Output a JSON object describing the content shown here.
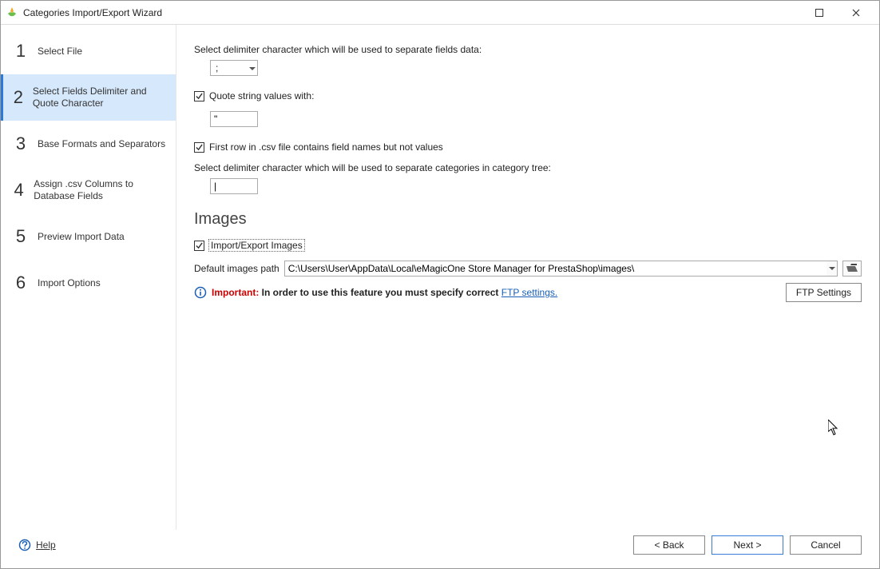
{
  "window": {
    "title": "Categories Import/Export Wizard"
  },
  "sidebar": {
    "steps": [
      {
        "num": "1",
        "label": "Select File"
      },
      {
        "num": "2",
        "label": "Select Fields Delimiter and Quote Character"
      },
      {
        "num": "3",
        "label": "Base Formats and Separators"
      },
      {
        "num": "4",
        "label": "Assign .csv Columns to Database Fields"
      },
      {
        "num": "5",
        "label": "Preview Import Data"
      },
      {
        "num": "6",
        "label": "Import Options"
      }
    ],
    "active_index": 1
  },
  "form": {
    "delimiter_label": "Select delimiter character which will be used to separate fields data:",
    "delimiter_value": ";",
    "quote_check_label": "Quote string values with:",
    "quote_value": "\"",
    "first_row_label": "First row in .csv file contains field names but not values",
    "category_delim_label": "Select delimiter character which will be used to separate categories in category tree:",
    "category_delim_value": "|"
  },
  "images": {
    "section_title": "Images",
    "import_export_label": "Import/Export Images",
    "path_label": "Default images path",
    "path_value": "C:\\Users\\User\\AppData\\Local\\eMagicOne Store Manager for PrestaShop\\images\\",
    "important_label": "Important:",
    "important_text": " In order to use this feature you must specify correct ",
    "ftp_link_label": "FTP settings.",
    "ftp_button_label": "FTP Settings"
  },
  "footer": {
    "help_label": "Help",
    "back_label": "< Back",
    "next_label": "Next >",
    "cancel_label": "Cancel"
  }
}
